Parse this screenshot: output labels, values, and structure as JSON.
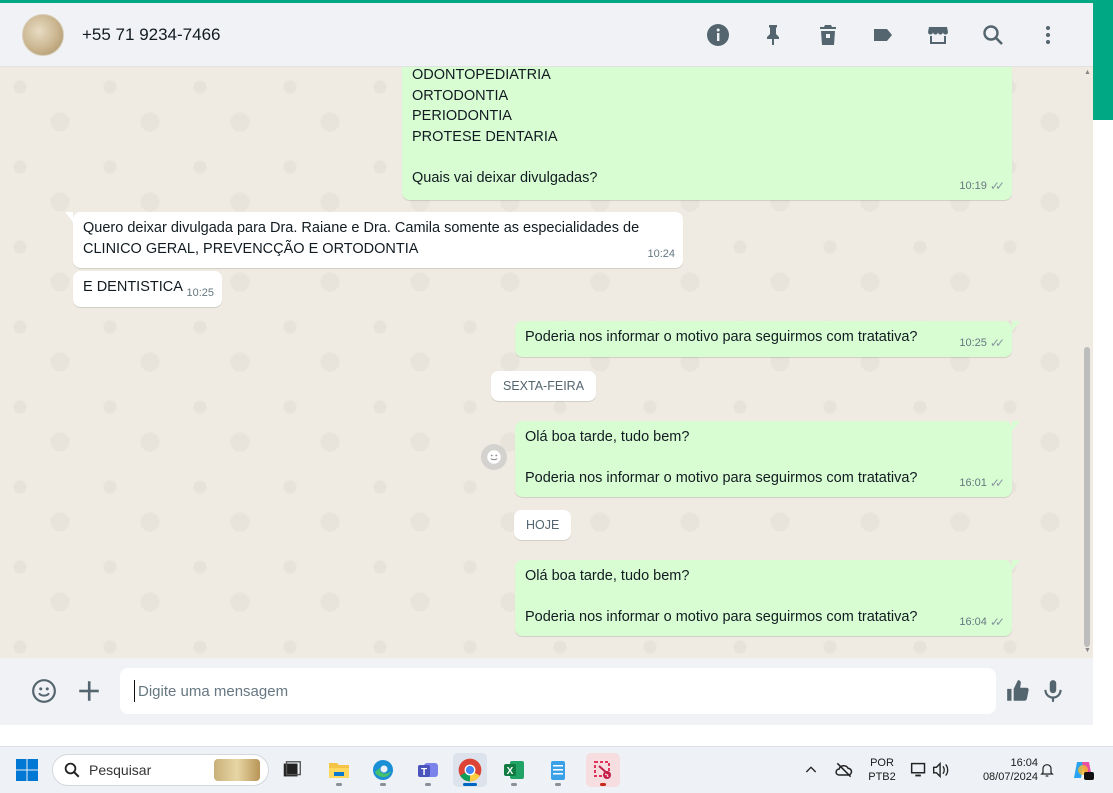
{
  "header": {
    "contact_name": "+55 71 9234-7466",
    "icons": [
      "info-icon",
      "pin-icon",
      "delete-icon",
      "label-icon",
      "store-icon",
      "search-icon",
      "menu-icon"
    ]
  },
  "messages": {
    "m1": {
      "lines": [
        "ODONTOPEDIATRIA",
        "ORTODONTIA",
        "PERIODONTIA",
        "PROTESE DENTARIA",
        "",
        "Quais vai deixar divulgadas?"
      ],
      "time": "10:19"
    },
    "m2": {
      "lines": [
        "Quero deixar divulgada para Dra. Raiane e Dra. Camila somente as especialidades de",
        "CLINICO GERAL, PREVENCÇÃO E ORTODONTIA"
      ],
      "time": "10:24"
    },
    "m3": {
      "text": "E DENTISTICA",
      "time": "10:25"
    },
    "m4": {
      "text": "Poderia nos informar o motivo para seguirmos com tratativa?",
      "time": "10:25"
    },
    "m5": {
      "line1": "Olá boa tarde, tudo bem?",
      "line2": "Poderia nos informar o motivo para seguirmos com tratativa?",
      "time": "16:01"
    },
    "m6": {
      "line1": "Olá boa tarde, tudo bem?",
      "line2": "Poderia nos informar o motivo para seguirmos com tratativa?",
      "time": "16:04"
    }
  },
  "dividers": {
    "friday": "SEXTA-FEIRA",
    "today": "HOJE"
  },
  "composer": {
    "placeholder": "Digite uma mensagem"
  },
  "taskbar": {
    "search_label": "Pesquisar",
    "lang_top": "POR",
    "lang_bottom": "PTB2",
    "time": "16:04",
    "date": "08/07/2024"
  },
  "colors": {
    "accent": "#00a884",
    "outgoing_bubble": "#d9fdd3",
    "chat_bg": "#efeae2"
  }
}
